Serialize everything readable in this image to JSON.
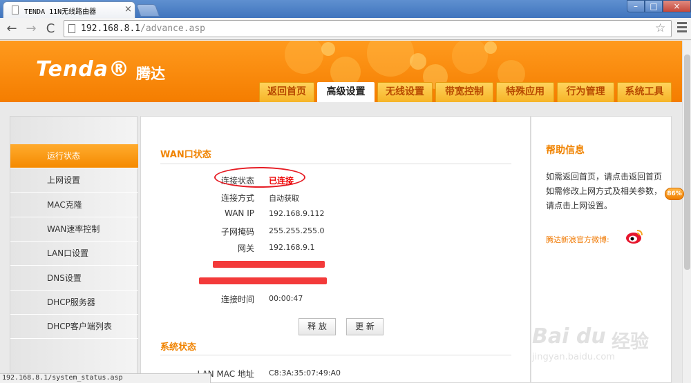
{
  "browser": {
    "tab_title": "TENDA 11N无线路由器",
    "close_glyph": "×",
    "url_host": "192.168.8.1",
    "url_path": "/advance.asp",
    "status_url": "192.168.8.1/system_status.asp",
    "back_glyph": "←",
    "forward_glyph": "→",
    "reload_glyph": "C",
    "star_glyph": "☆",
    "win_min": "–",
    "win_max": "□",
    "win_close": "×"
  },
  "brand": {
    "logo": "Tenda®",
    "name_cn": "腾达"
  },
  "nav": {
    "tabs": [
      "返回首页",
      "高级设置",
      "无线设置",
      "带宽控制",
      "特殊应用",
      "行为管理",
      "系统工具"
    ],
    "active_index": 1
  },
  "sidebar": {
    "items": [
      "运行状态",
      "上网设置",
      "MAC克隆",
      "WAN速率控制",
      "LAN口设置",
      "DNS设置",
      "DHCP服务器",
      "DHCP客户端列表"
    ],
    "active_index": 0
  },
  "wan": {
    "title": "WAN口状态",
    "rows": [
      {
        "label": "连接状态",
        "value": "已连接"
      },
      {
        "label": "连接方式",
        "value": "自动获取"
      },
      {
        "label": "WAN IP",
        "value": "192.168.9.112"
      },
      {
        "label": "子网掩码",
        "value": "255.255.255.0"
      },
      {
        "label": "网关",
        "value": "192.168.9.1"
      },
      {
        "label": "连接时间",
        "value": "00:00:47"
      }
    ],
    "release_label": "释 放",
    "refresh_label": "更 新"
  },
  "system": {
    "title": "系统状态",
    "rows": [
      {
        "label": "LAN MAC 地址",
        "value": "C8:3A:35:07:49:A0"
      }
    ]
  },
  "help": {
    "title": "帮助信息",
    "text_1": "如需返回首页，请点击返回首页",
    "text_2": "如需修改上网方式及相关参数，请点击上网设置。",
    "weibo_label": "腾达新浪官方微博:"
  },
  "overlay": {
    "percent_badge": "86%",
    "watermark_text": "Bai du",
    "watermark_cn": "经验",
    "watermark_url": "jingyan.baidu.com"
  },
  "colors": {
    "brand_orange": "#f47d00",
    "accent_text": "#f08300",
    "status_red": "#e00000"
  }
}
